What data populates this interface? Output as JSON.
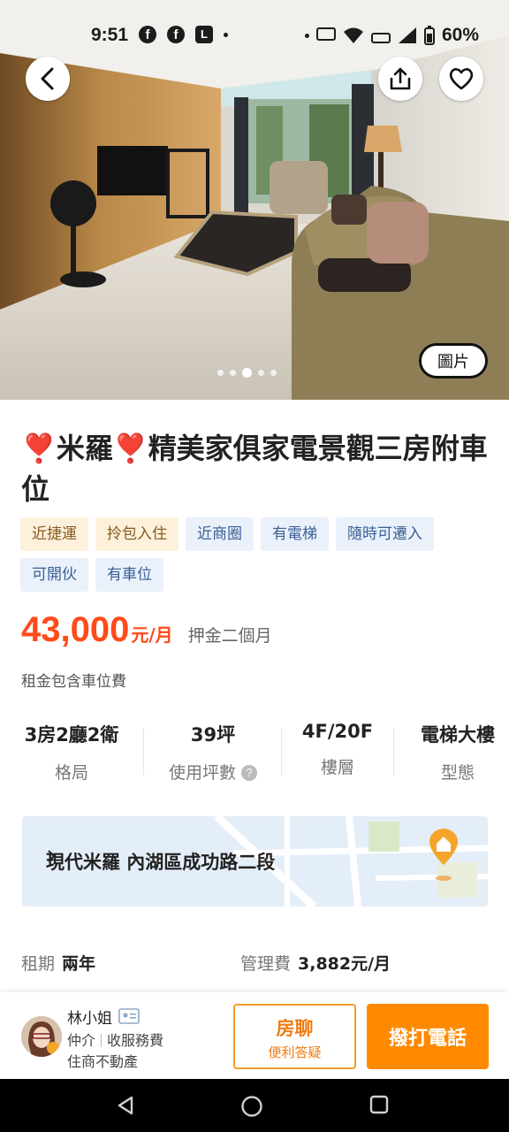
{
  "status_bar": {
    "time": "9:51",
    "left_icons": [
      "facebook-icon",
      "facebook-icon",
      "line-icon"
    ],
    "right_icons": [
      "auto-hd-icon",
      "wifi-icon",
      "volte-icon",
      "signal-icon",
      "battery-icon"
    ],
    "battery": "60%"
  },
  "gallery": {
    "photo_button": "圖片",
    "dot_count": 5,
    "active_dot": 3
  },
  "listing": {
    "title": "❣️米羅❣️精美家俱家電景觀三房附車位",
    "tags": [
      {
        "label": "近捷運",
        "style": "warm"
      },
      {
        "label": "拎包入住",
        "style": "warm"
      },
      {
        "label": "近商圈",
        "style": "cool"
      },
      {
        "label": "有電梯",
        "style": "cool"
      },
      {
        "label": "隨時可遷入",
        "style": "cool"
      },
      {
        "label": "可開伙",
        "style": "cool"
      },
      {
        "label": "有車位",
        "style": "cool"
      }
    ],
    "price": "43,000",
    "price_unit": "元/月",
    "deposit": "押金二個月",
    "note": "租金包含車位費",
    "specs": [
      {
        "value": "3房2廳2衛",
        "label": "格局"
      },
      {
        "value": "39坪",
        "label": "使用坪數"
      },
      {
        "value": "4F/20F",
        "label": "樓層"
      },
      {
        "value": "電梯大樓",
        "label": "型態"
      }
    ],
    "address": "現代米羅 內湖區成功路二段",
    "lease_label": "租期",
    "lease_value": "兩年",
    "fee_label": "管理費",
    "fee_value": "3,882元/月"
  },
  "agent": {
    "name": "林小姐",
    "role": "仲介",
    "service_fee": "收服務費",
    "company": "住商不動產"
  },
  "actions": {
    "chat_title": "房聊",
    "chat_sub": "便利答疑",
    "call_label": "撥打電話"
  },
  "colors": {
    "price": "#ff4a1a",
    "accent": "#ff8a00",
    "tag_warm_bg": "#fdf1dc",
    "tag_cool_bg": "#eaf1fb"
  }
}
